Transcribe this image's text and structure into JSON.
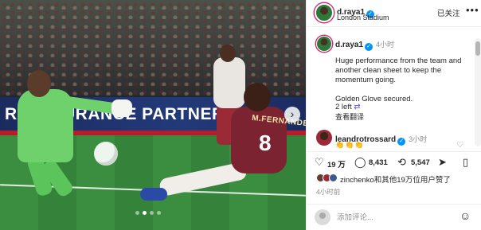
{
  "post": {
    "photo": {
      "ad_text": "RE INSURANCE PARTNER",
      "shirt_name": "M.FERNANDES",
      "shirt_number": "8",
      "carousel_dots": 4,
      "active_dot": 1
    },
    "header": {
      "username": "d.raya1",
      "verified_mark": "✓",
      "location": "London Stadium",
      "follow_label": "已关注",
      "more_icon": "•••"
    },
    "caption": {
      "username": "d.raya1",
      "time": "4小时",
      "text_1": "Huge performance from the team and another clean sheet to keep the momentum going.",
      "text_2": "Golden Glove secured.",
      "left_link": "2 left",
      "translate_label": "查看翻译"
    },
    "comment": {
      "username": "leandrotrossard",
      "time": "3小时",
      "emojis": "👏👏👏"
    },
    "actions": {
      "like_count": "19 万",
      "comment_count": "8,431",
      "share_count": "5,547"
    },
    "likes": {
      "text": "zinchenko和其他19万位用户赞了",
      "post_time": "4小时前"
    },
    "add_comment": {
      "placeholder": "添加评论..."
    }
  }
}
